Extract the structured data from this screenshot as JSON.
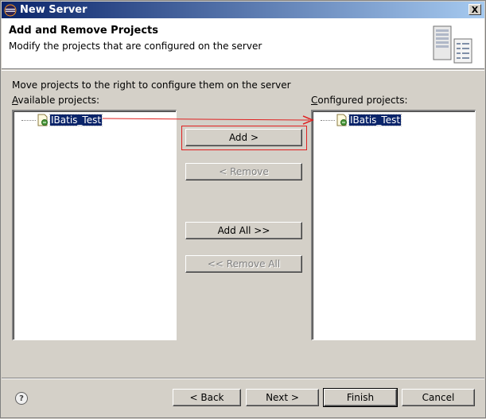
{
  "window": {
    "title": "New Server",
    "close_glyph": "X"
  },
  "header": {
    "title": "Add and Remove Projects",
    "description": "Modify the projects that are configured on the server",
    "graphic_icon": "server-wizard-icon"
  },
  "instruction": "Move projects to the right to configure them on the server",
  "available": {
    "label": "Available projects:",
    "items": [
      "IBatis_Test"
    ]
  },
  "configured": {
    "label": "Configured projects:",
    "items": [
      "IBatis_Test"
    ]
  },
  "actions": {
    "add": "Add >",
    "remove": "< Remove",
    "add_all": "Add All >>",
    "remove_all": "<< Remove All"
  },
  "footer": {
    "help_glyph": "?",
    "back": "< Back",
    "next": "Next >",
    "finish": "Finish",
    "cancel": "Cancel"
  },
  "colors": {
    "titlebar_start": "#0a246a",
    "titlebar_end": "#a6caf0",
    "selection": "#0a246a",
    "annotation_red": "#e02020",
    "dialog_bg": "#d4d0c8"
  }
}
